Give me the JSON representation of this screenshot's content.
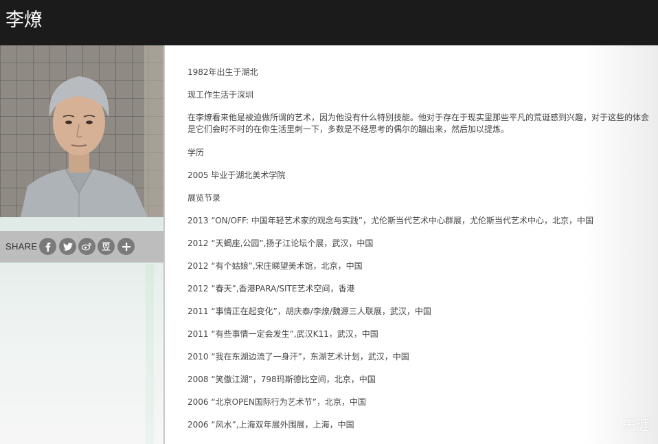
{
  "header": {
    "title": "李燎"
  },
  "sidebar": {
    "portrait_alt": "artist-portrait",
    "share": {
      "label": "SHARE",
      "buttons": [
        {
          "name": "facebook-icon",
          "glyph": "f"
        },
        {
          "name": "twitter-icon",
          "glyph": "🐦"
        },
        {
          "name": "weibo-icon",
          "glyph": "◎"
        },
        {
          "name": "douban-icon",
          "glyph": "豆"
        },
        {
          "name": "more-icon",
          "glyph": "+"
        }
      ]
    }
  },
  "bio": {
    "born": "1982年出生于湖北",
    "lives": "现工作生活于深圳",
    "statement": "在李燎看来他是被迫做所谓的艺术，因为他没有什么特别技能。他对于存在于现实里那些平凡的荒诞感到兴趣，对于这些的体会是它们会时不时的在你生活里刺一下，多数是不经思考的偶尔的蹦出来，然后加以提炼。",
    "education_heading": "学历",
    "education": "2005 毕业于湖北美术学院",
    "exhibitions_heading": "展览节录",
    "exhibitions": [
      "2013 “ON/OFF: 中国年轻艺术家的观念与实践”，尤伦斯当代艺术中心群展，尤伦斯当代艺术中心，北京，中国",
      "2012 “天蝎座,公园”,扬子江论坛个展，武汉，中国",
      "2012 “有个姑娘”,宋庄睇望美术馆，北京，中国",
      "2012 “春天”,香港PARA/SITE艺术空间，香港",
      "2011 “事情正在起变化”，胡庆泰/李燎/魏源三人联展，武汉，中国",
      "2011 “有些事情一定会发生”,武汉K11，武汉，中国",
      "2010 “我在东湖边流了一身汗”，东湖艺术计划，武汉，中国",
      "2008 “笑傲江湖”，798玛斯德比空间，北京，中国",
      "2006 “北京OPEN国际行为艺术节”，北京，中国",
      "2006 “风水”,上海双年展外围展，上海，中国"
    ]
  },
  "watermark": "天涯",
  "colors": {
    "header_bg": "#1b1b1b",
    "share_bar_bg": "#bdbdbd",
    "share_button_bg": "#7a7a7a",
    "text": "#444444"
  }
}
